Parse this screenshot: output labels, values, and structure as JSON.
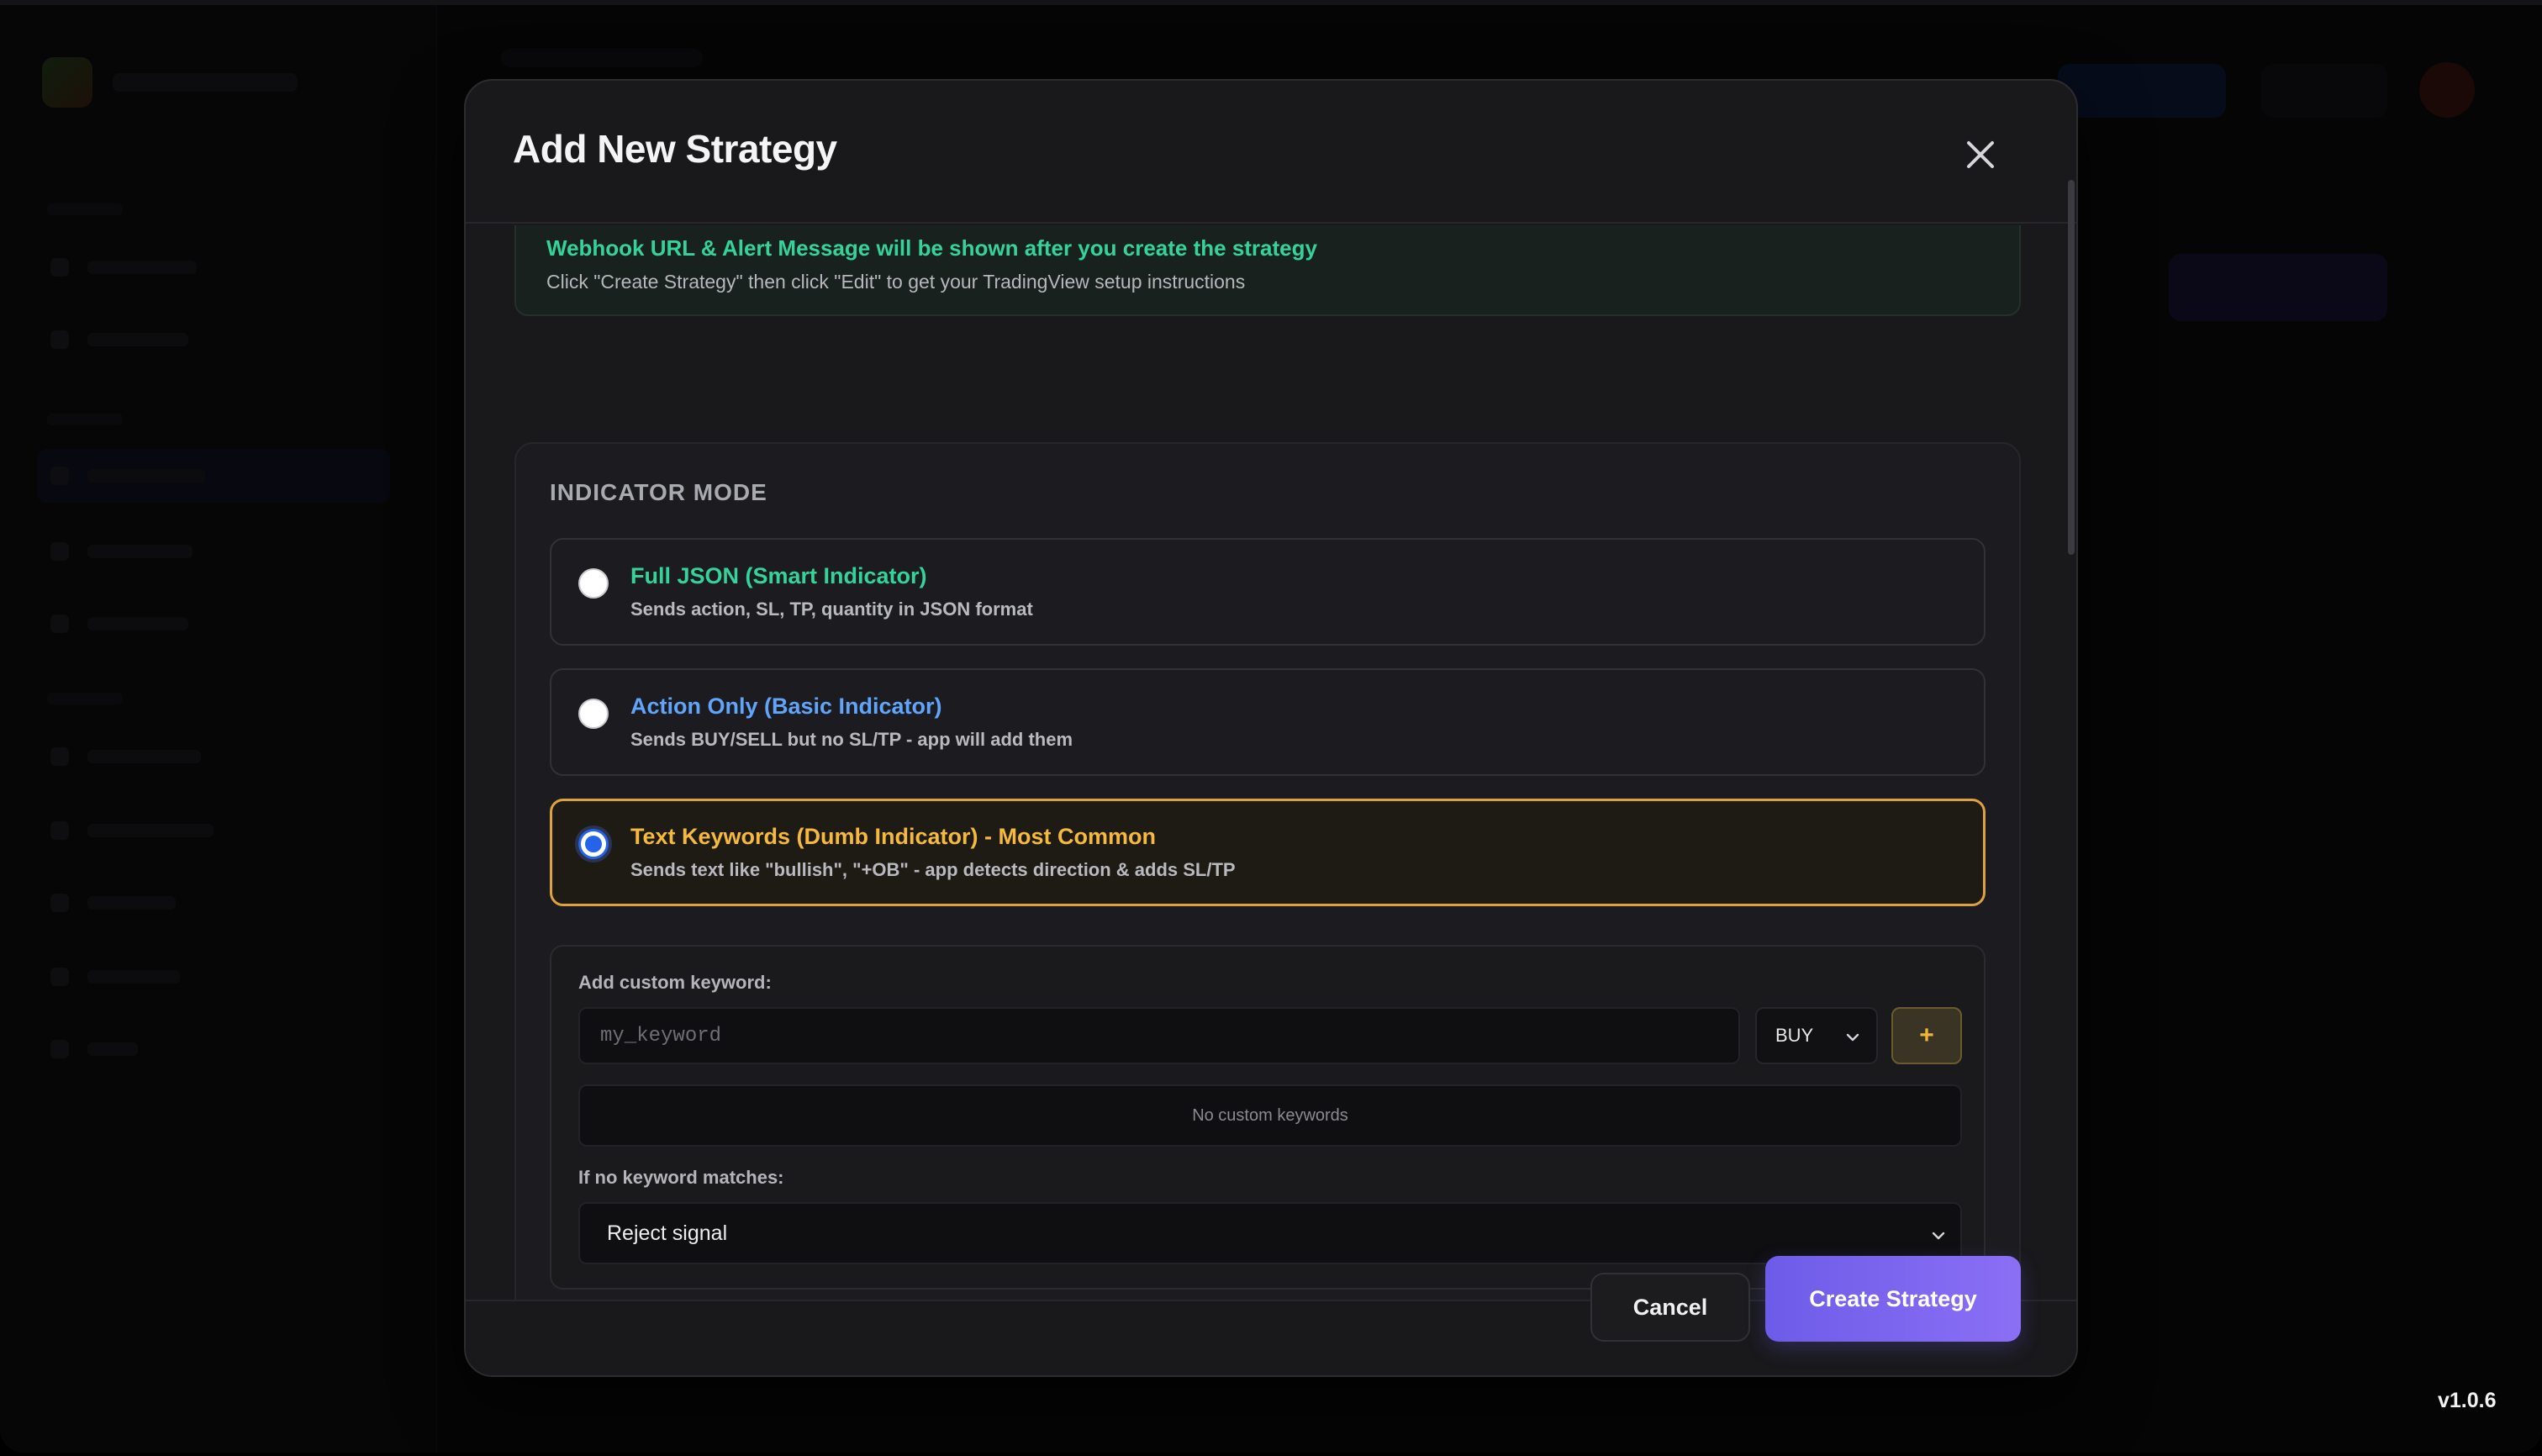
{
  "modal": {
    "title": "Add New Strategy",
    "close_icon": "close-icon"
  },
  "webhook_banner": {
    "title": "Webhook URL & Alert Message will be shown after you create the strategy",
    "subtitle": "Click \"Create Strategy\" then click \"Edit\" to get your TradingView setup instructions"
  },
  "indicator_mode": {
    "heading": "INDICATOR MODE",
    "options": [
      {
        "title": "Full JSON (Smart Indicator)",
        "description": "Sends action, SL, TP, quantity in JSON format",
        "color": "#34d399",
        "selected": false
      },
      {
        "title": "Action Only (Basic Indicator)",
        "description": "Sends BUY/SELL but no SL/TP - app will add them",
        "color": "#60a5fa",
        "selected": false
      },
      {
        "title": "Text Keywords (Dumb Indicator) - Most Common",
        "description": "Sends text like \"bullish\", \"+OB\" - app detects direction & adds SL/TP",
        "color": "#f5b93e",
        "selected": true
      }
    ]
  },
  "keywords": {
    "add_label": "Add custom keyword:",
    "input_placeholder": "my_keyword",
    "input_value": "",
    "direction_value": "BUY",
    "add_button": "+",
    "empty_text": "No custom keywords",
    "no_match_label": "If no keyword matches:",
    "no_match_value": "Reject signal"
  },
  "footer": {
    "cancel": "Cancel",
    "create": "Create Strategy"
  },
  "app": {
    "version": "v1.0.6"
  },
  "colors": {
    "accent_green": "#34d399",
    "accent_blue": "#60a5fa",
    "accent_amber": "#f5b93e",
    "primary_purple": "#7c66ee"
  }
}
